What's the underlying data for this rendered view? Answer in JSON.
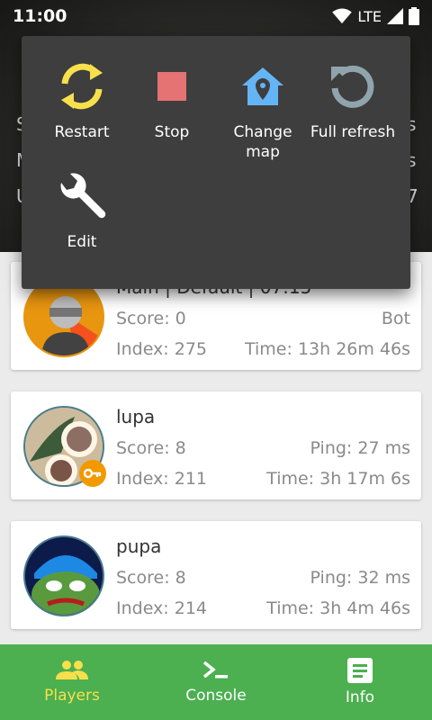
{
  "status": {
    "time": "11:00",
    "network": "LTE"
  },
  "hero": {
    "letters": [
      "S",
      "M",
      "U",
      "s",
      "s",
      "7"
    ]
  },
  "popup": {
    "actions": [
      {
        "label": "Restart",
        "icon": "restart-icon",
        "color": "#f7e04b"
      },
      {
        "label": "Stop",
        "icon": "stop-icon",
        "color": "#e57373"
      },
      {
        "label": "Change map",
        "icon": "map-marker-icon",
        "color": "#64b5f6"
      },
      {
        "label": "Full refresh",
        "icon": "refresh-icon",
        "color": "#90a4ae"
      },
      {
        "label": "Edit",
        "icon": "wrench-icon",
        "color": "#ffffff"
      }
    ]
  },
  "players": [
    {
      "name": "Main | Default | 07:15",
      "score": "Score: 0",
      "right1": "Bot",
      "index": "Index: 275",
      "time": "Time: 13h 26m 46s",
      "admin": false
    },
    {
      "name": "lupa",
      "score": "Score: 8",
      "right1": "Ping: 27 ms",
      "index": "Index: 211",
      "time": "Time: 3h 17m 6s",
      "admin": true
    },
    {
      "name": "pupa",
      "score": "Score: 8",
      "right1": "Ping: 32 ms",
      "index": "Index: 214",
      "time": "Time: 3h 4m 46s",
      "admin": false
    }
  ],
  "nav": [
    {
      "label": "Players",
      "icon": "players-icon",
      "active": true
    },
    {
      "label": "Console",
      "icon": "console-icon",
      "active": false
    },
    {
      "label": "Info",
      "icon": "info-icon",
      "active": false
    }
  ],
  "colors": {
    "accent": "#4caf50",
    "active": "#f7e04b",
    "popup": "#3e3e3e"
  }
}
